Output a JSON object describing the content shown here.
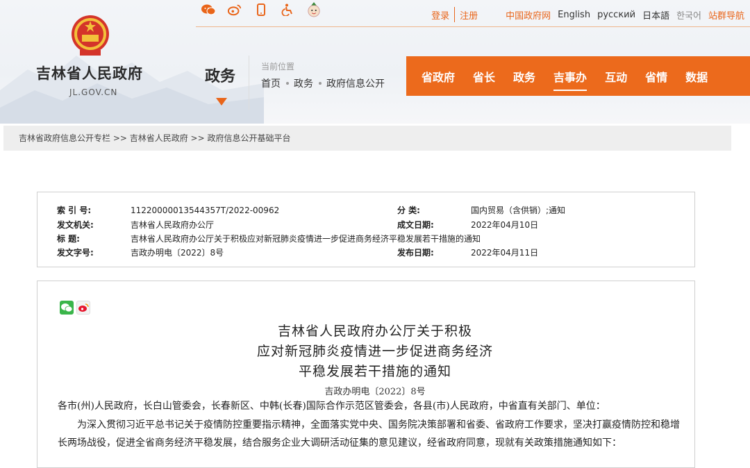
{
  "header": {
    "site_title": "吉林省人民政府",
    "site_domain": "JL.GOV.CN",
    "section_title": "政务",
    "location_label": "当前位置",
    "location_crumbs": [
      "首页",
      "政务",
      "政府信息公开"
    ],
    "top_icons": [
      "weibo-icon",
      "weibo-icon-alt",
      "mobile-icon",
      "accessibility-icon",
      "mascot-icon"
    ],
    "top_links": {
      "login": "登录",
      "register": "注册",
      "gov_portal": "中国政府网",
      "english": "English",
      "russian": "русский",
      "japanese": "日本語",
      "korean": "한국어",
      "site_nav": "站群导航"
    },
    "nav": [
      {
        "label": "省政府",
        "active": false
      },
      {
        "label": "省长",
        "active": false
      },
      {
        "label": "政务",
        "active": false
      },
      {
        "label": "吉事办",
        "active": true
      },
      {
        "label": "互动",
        "active": false
      },
      {
        "label": "省情",
        "active": false
      },
      {
        "label": "数据",
        "active": false
      }
    ],
    "accent_color": "#ec6a1c"
  },
  "breadcrumb": {
    "text": "吉林省政府信息公开专栏 >> 吉林省人民政府 >> 政府信息公开基础平台"
  },
  "info": {
    "index_label": "索 引 号:",
    "index_value": "11220000013544357T/2022-00962",
    "category_label": "分 类:",
    "category_value": "国内贸易（含供销）;通知",
    "issuer_label": "发文机关:",
    "issuer_value": "吉林省人民政府办公厅",
    "date_label": "成文日期:",
    "date_value": "2022年04月10日",
    "title_label": "标 题:",
    "title_value": "吉林省人民政府办公厅关于积极应对新冠肺炎疫情进一步促进商务经济平稳发展若干措施的通知",
    "doc_no_label": "发文字号:",
    "doc_no_value": "吉政办明电〔2022〕8号",
    "publish_label": "发布日期:",
    "publish_value": "2022年04月11日"
  },
  "article": {
    "title_lines": [
      "吉林省人民政府办公厅关于积极",
      "应对新冠肺炎疫情进一步促进商务经济",
      "平稳发展若干措施的通知"
    ],
    "doc_no": "吉政办明电〔2022〕8号",
    "addressees": "各市(州)人民政府，长白山管委会，长春新区、中韩(长春)国际合作示范区管委会，各县(市)人民政府，中省直有关部门、单位：",
    "intro_line1": "为深入贯彻习近平总书记关于疫情防控重要指示精神，全面落实党中央、国务院决策部署和省委、省政府工作要求，坚决打赢疫情防控和稳增",
    "intro_line2": "长两场战役，促进全省商务经济平稳发展，结合服务企业大调研活动征集的意见建议，经省政府同意，现就有关政策措施通知如下："
  }
}
